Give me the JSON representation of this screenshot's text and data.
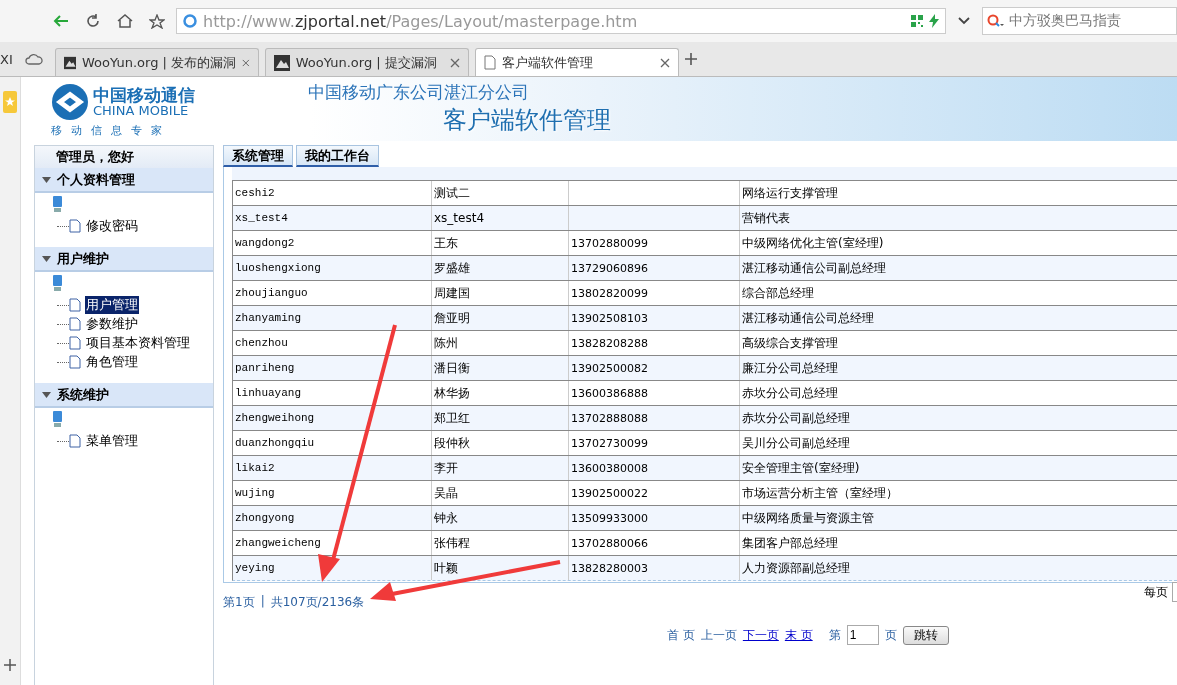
{
  "browser": {
    "address_prefix": "http://www.",
    "address_domain": "zjportal.net",
    "address_path": "/Pages/Layout/masterpage.htm",
    "search": "中方驳奥巴马指责",
    "tab_fragment": "XI",
    "tabs": [
      {
        "title": "WooYun.org | 发布的漏洞",
        "kind": "site",
        "selected": false
      },
      {
        "title": "WooYun.org | 提交漏洞",
        "kind": "site",
        "selected": false
      },
      {
        "title": "客户端软件管理",
        "kind": "page",
        "selected": true
      }
    ]
  },
  "header": {
    "logo_cn": "中国移动通信",
    "logo_en": "CHINA MOBILE",
    "logo_slogan": "移动信息专家",
    "company": "中国移动广东公司湛江分公司",
    "system": "客户端软件管理"
  },
  "sidebar": {
    "greeting": "管理员，您好",
    "sections": [
      {
        "title": "个人资料管理",
        "expanded": true,
        "items": [
          {
            "label": "修改密码",
            "selected": false
          }
        ]
      },
      {
        "title": "用户维护",
        "expanded": true,
        "items": [
          {
            "label": "用户管理",
            "selected": true
          },
          {
            "label": "参数维护",
            "selected": false
          },
          {
            "label": "项目基本资料管理",
            "selected": false
          },
          {
            "label": "角色管理",
            "selected": false
          }
        ]
      },
      {
        "title": "系统维护",
        "expanded": true,
        "items": [
          {
            "label": "菜单管理",
            "selected": false
          }
        ]
      }
    ]
  },
  "content_tabs": [
    {
      "label": "系统管理",
      "selected": false
    },
    {
      "label": "我的工作台",
      "selected": false
    }
  ],
  "table": {
    "rows": [
      [
        "ceshi2",
        "测试二",
        "",
        "网络运行支撑管理"
      ],
      [
        "xs_test4",
        "xs_test4",
        "",
        "营销代表"
      ],
      [
        "wangdong2",
        "王东",
        "13702880099",
        "中级网络优化主管(室经理)"
      ],
      [
        "luoshengxiong",
        "罗盛雄",
        "13729060896",
        "湛江移动通信公司副总经理"
      ],
      [
        "zhoujianguo",
        "周建国",
        "13802820099",
        "综合部总经理"
      ],
      [
        "zhanyaming",
        "詹亚明",
        "13902508103",
        "湛江移动通信公司总经理"
      ],
      [
        "chenzhou",
        "陈州",
        "13828208288",
        "高级综合支撑管理"
      ],
      [
        "panriheng",
        "潘日衡",
        "13902500082",
        "廉江分公司总经理"
      ],
      [
        "linhuayang",
        "林华扬",
        "13600386888",
        "赤坎分公司总经理"
      ],
      [
        "zhengweihong",
        "郑卫红",
        "13702888088",
        "赤坎分公司副总经理"
      ],
      [
        "duanzhongqiu",
        "段仲秋",
        "13702730099",
        "吴川分公司副总经理"
      ],
      [
        "likai2",
        "李开",
        "13600380008",
        "安全管理主管(室经理)"
      ],
      [
        "wujing",
        "吴晶",
        "13902500022",
        "市场运营分析主管（室经理）"
      ],
      [
        "zhongyong",
        "钟永",
        "13509933000",
        "中级网络质量与资源主管"
      ],
      [
        "zhangweicheng",
        "张伟程",
        "13702880066",
        "集团客户部总经理"
      ],
      [
        "yeying",
        "叶颖",
        "13828280003",
        "人力资源部副总经理"
      ]
    ]
  },
  "pagination": {
    "current": "第1页",
    "separator": "|",
    "total": "共107页/2136条",
    "per_page_label": "每页",
    "nav": [
      {
        "label": "首 页",
        "kind": "plain"
      },
      {
        "label": "上一页",
        "kind": "plain"
      },
      {
        "label": "下一页",
        "kind": "link"
      },
      {
        "label": "末 页",
        "kind": "link"
      }
    ],
    "page_before": "第",
    "page_value": "1",
    "page_after": "页",
    "go_button": "跳转"
  }
}
